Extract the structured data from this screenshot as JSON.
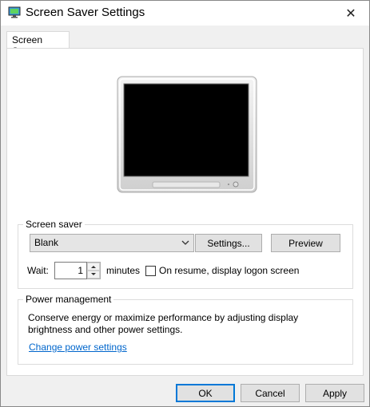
{
  "window": {
    "title": "Screen Saver Settings",
    "close_glyph": "✕"
  },
  "tabs": [
    {
      "label": "Screen Saver",
      "selected": true
    }
  ],
  "screen_saver": {
    "group_label": "Screen saver",
    "selected": "Blank",
    "settings_label": "Settings...",
    "preview_label": "Preview",
    "wait_label": "Wait:",
    "wait_value": "1",
    "minutes_label": "minutes",
    "resume_label": "On resume, display logon screen",
    "resume_checked": false
  },
  "power": {
    "group_label": "Power management",
    "description_line1": "Conserve energy or maximize performance by adjusting display",
    "description_line2": "brightness and other power settings.",
    "link_label": "Change power settings"
  },
  "footer": {
    "ok_label": "OK",
    "cancel_label": "Cancel",
    "apply_label": "Apply"
  },
  "icons": {
    "app": "monitor-app-icon",
    "close": "close-icon",
    "dropdown": "chevron-down-icon",
    "spin_up": "spin-up-icon",
    "spin_down": "spin-down-icon"
  },
  "colors": {
    "link": "#0066cc",
    "default_button_border": "#0078d7",
    "monitor_screen": "#000000"
  }
}
